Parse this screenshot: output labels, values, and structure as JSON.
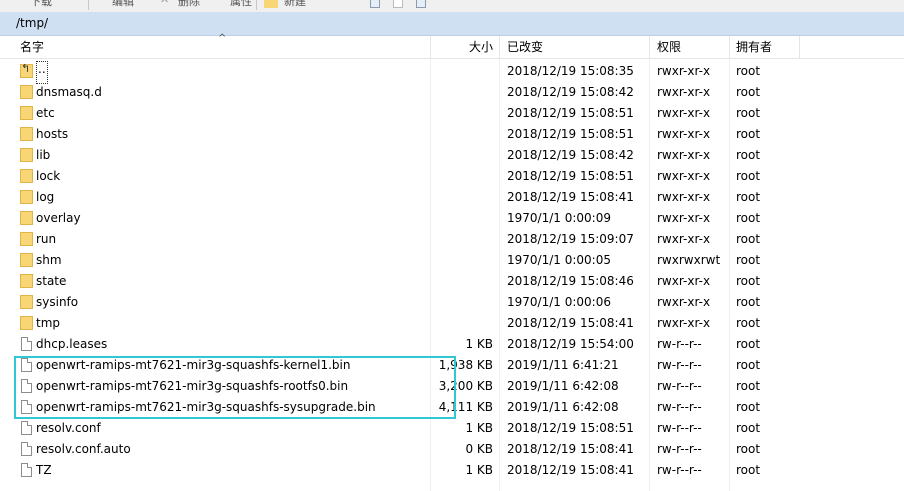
{
  "toolbar": {
    "items": [
      {
        "label": "下载",
        "icon": "download-icon"
      },
      {
        "label": "编辑",
        "icon": "edit-icon"
      },
      {
        "label": "删除",
        "icon": "delete-icon"
      },
      {
        "label": "属性",
        "icon": "properties-icon"
      },
      {
        "label": "新建",
        "icon": "new-folder-icon"
      }
    ]
  },
  "path": "/tmp/",
  "columns": {
    "name": "名字",
    "size": "大小",
    "modified": "已改变",
    "permissions": "权限",
    "owner": "拥有者"
  },
  "files": [
    {
      "type": "up",
      "name": "..",
      "size": "",
      "modified": "2018/12/19 15:08:35",
      "perm": "rwxr-xr-x",
      "owner": "root"
    },
    {
      "type": "folder",
      "name": "dnsmasq.d",
      "size": "",
      "modified": "2018/12/19 15:08:42",
      "perm": "rwxr-xr-x",
      "owner": "root"
    },
    {
      "type": "folder",
      "name": "etc",
      "size": "",
      "modified": "2018/12/19 15:08:51",
      "perm": "rwxr-xr-x",
      "owner": "root"
    },
    {
      "type": "folder",
      "name": "hosts",
      "size": "",
      "modified": "2018/12/19 15:08:51",
      "perm": "rwxr-xr-x",
      "owner": "root"
    },
    {
      "type": "folder",
      "name": "lib",
      "size": "",
      "modified": "2018/12/19 15:08:42",
      "perm": "rwxr-xr-x",
      "owner": "root"
    },
    {
      "type": "folder",
      "name": "lock",
      "size": "",
      "modified": "2018/12/19 15:08:51",
      "perm": "rwxr-xr-x",
      "owner": "root"
    },
    {
      "type": "folder",
      "name": "log",
      "size": "",
      "modified": "2018/12/19 15:08:41",
      "perm": "rwxr-xr-x",
      "owner": "root"
    },
    {
      "type": "folder",
      "name": "overlay",
      "size": "",
      "modified": "1970/1/1 0:00:09",
      "perm": "rwxr-xr-x",
      "owner": "root"
    },
    {
      "type": "folder",
      "name": "run",
      "size": "",
      "modified": "2018/12/19 15:09:07",
      "perm": "rwxr-xr-x",
      "owner": "root"
    },
    {
      "type": "folder",
      "name": "shm",
      "size": "",
      "modified": "1970/1/1 0:00:05",
      "perm": "rwxrwxrwt",
      "owner": "root"
    },
    {
      "type": "folder",
      "name": "state",
      "size": "",
      "modified": "2018/12/19 15:08:46",
      "perm": "rwxr-xr-x",
      "owner": "root"
    },
    {
      "type": "folder",
      "name": "sysinfo",
      "size": "",
      "modified": "1970/1/1 0:00:06",
      "perm": "rwxr-xr-x",
      "owner": "root"
    },
    {
      "type": "folder",
      "name": "tmp",
      "size": "",
      "modified": "2018/12/19 15:08:41",
      "perm": "rwxr-xr-x",
      "owner": "root"
    },
    {
      "type": "file",
      "name": "dhcp.leases",
      "size": "1 KB",
      "modified": "2018/12/19 15:54:00",
      "perm": "rw-r--r--",
      "owner": "root"
    },
    {
      "type": "file",
      "name": "openwrt-ramips-mt7621-mir3g-squashfs-kernel1.bin",
      "size": "1,938 KB",
      "modified": "2019/1/11 6:41:21",
      "perm": "rw-r--r--",
      "owner": "root"
    },
    {
      "type": "file",
      "name": "openwrt-ramips-mt7621-mir3g-squashfs-rootfs0.bin",
      "size": "3,200 KB",
      "modified": "2019/1/11 6:42:08",
      "perm": "rw-r--r--",
      "owner": "root"
    },
    {
      "type": "file",
      "name": "openwrt-ramips-mt7621-mir3g-squashfs-sysupgrade.bin",
      "size": "4,111 KB",
      "modified": "2019/1/11 6:42:08",
      "perm": "rw-r--r--",
      "owner": "root"
    },
    {
      "type": "file",
      "name": "resolv.conf",
      "size": "1 KB",
      "modified": "2018/12/19 15:08:51",
      "perm": "rw-r--r--",
      "owner": "root"
    },
    {
      "type": "file",
      "name": "resolv.conf.auto",
      "size": "0 KB",
      "modified": "2018/12/19 15:08:41",
      "perm": "rw-r--r--",
      "owner": "root"
    },
    {
      "type": "file",
      "name": "TZ",
      "size": "1 KB",
      "modified": "2018/12/19 15:08:41",
      "perm": "rw-r--r--",
      "owner": "root"
    }
  ],
  "colors": {
    "pathbar": "#cfe0f3",
    "highlight": "#2fc8d4",
    "folder": "#f8d676"
  }
}
